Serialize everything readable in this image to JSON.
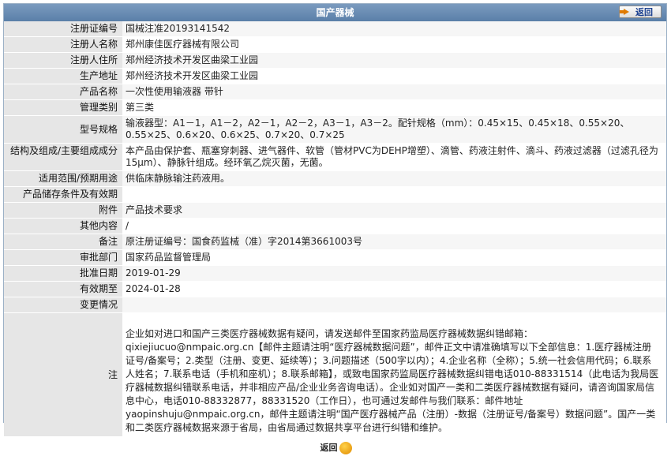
{
  "header": {
    "title": "国产器械",
    "back_label": "返回"
  },
  "rows": [
    {
      "label": "注册证编号",
      "value": "国械注准20193141542"
    },
    {
      "label": "注册人名称",
      "value": "郑州康佳医疗器械有限公司"
    },
    {
      "label": "注册人住所",
      "value": "郑州经济技术开发区曲梁工业园"
    },
    {
      "label": "生产地址",
      "value": "郑州经济技术开发区曲梁工业园"
    },
    {
      "label": "产品名称",
      "value": "一次性使用输液器 带针"
    },
    {
      "label": "管理类别",
      "value": "第三类"
    },
    {
      "label": "型号规格",
      "value": "输液器型：A1－1，A1－2，A2－1，A2－2，A3－1，A3－2。配针规格（mm）：0.45×15、0.45×18、0.55×20、0.55×25、0.6×20、0.6×25、0.7×20、0.7×25"
    },
    {
      "label": "结构及组成/主要组成成分",
      "value": "本产品由保护套、瓶塞穿刺器、进气器件、软管（管材PVC为DEHP增塑）、滴管、药液注射件、滴斗、药液过滤器（过滤孔径为15μm）、静脉针组成。经环氧乙烷灭菌，无菌。"
    },
    {
      "label": "适用范围/预期用途",
      "value": "供临床静脉输注药液用。"
    },
    {
      "label": "产品储存条件及有效期",
      "value": ""
    },
    {
      "label": "附件",
      "value": "产品技术要求"
    },
    {
      "label": "其他内容",
      "value": "/"
    },
    {
      "label": "备注",
      "value": "原注册证编号：国食药监械（准）字2014第3661003号"
    },
    {
      "label": "审批部门",
      "value": "国家药品监督管理局"
    },
    {
      "label": "批准日期",
      "value": "2019-01-29"
    },
    {
      "label": "有效期至",
      "value": "2024-01-28"
    },
    {
      "label": "变更情况",
      "value": ""
    }
  ],
  "note": {
    "label": "注",
    "text": "企业如对进口和国产三类医疗器械数据有疑问，请发送邮件至国家药监局医疗器械数据纠错邮箱：qixiejiucuo@nmpaic.org.cn【邮件主题请注明“医疗器械数据问题”，邮件正文中请准确填写以下全部信息：1.医疗器械注册证号/备案号；2.类型（注册、变更、延续等）；3.问题描述（500字以内）；4.企业名称（全称）；5.统一社会信用代码；6.联系人姓名；7.联系电话（手机和座机）；8.联系邮箱】，或致电国家药监局医疗器械数据纠错电话010-88331514（此电话为我局医疗器械数据纠错联系电话，并非相应产品/企业业务咨询电话）。企业如对国产一类和二类医疗器械数据有疑问，请咨询国家局信息中心，电话010-88332877，88331520（工作日），也可通过发邮件与我们联系：邮件地址yaopinshuju@nmpaic.org.cn，邮件主题请注明“国产医疗器械产品（注册）-数据（注册证号/备案号）数据问题”。国产一类和二类医疗器械数据来源于省局，由省局通过数据共享平台进行纠错和维护。"
  },
  "footer": {
    "back_label": "返回"
  }
}
